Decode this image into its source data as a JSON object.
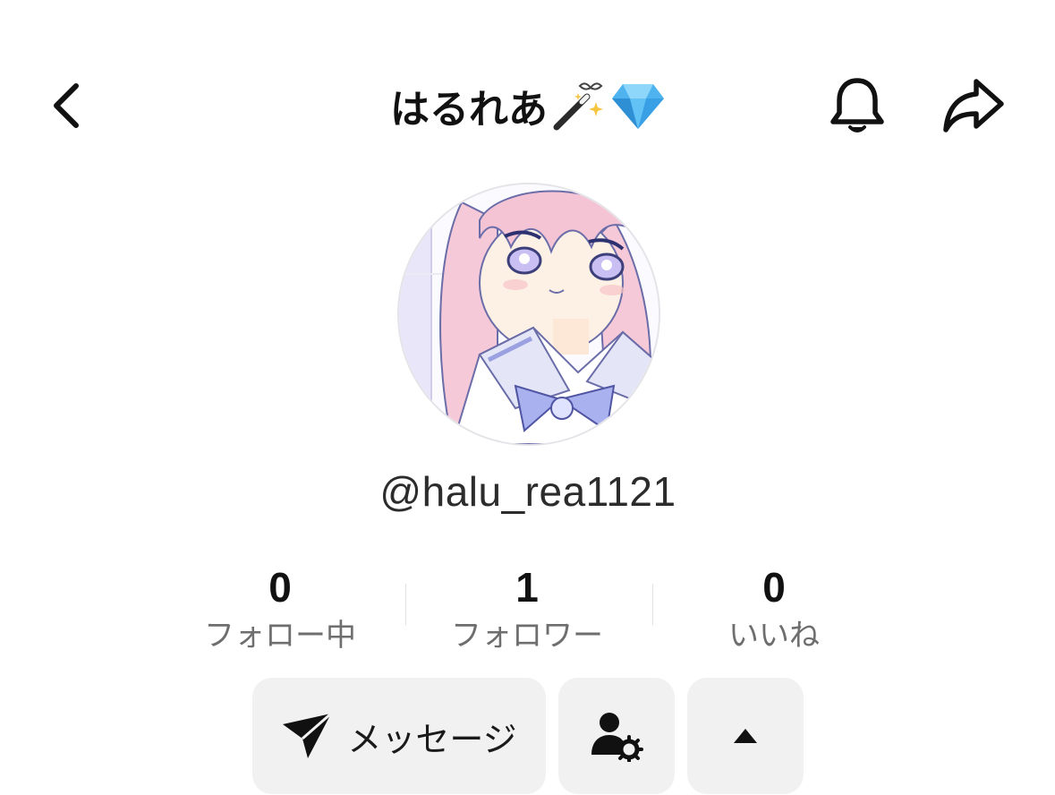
{
  "header": {
    "title": "はるれあ",
    "title_emojis": [
      "magic-wand-icon",
      "gem-icon"
    ],
    "back_icon": "chevron-left-icon",
    "bell_icon": "bell-icon",
    "share_icon": "share-arrow-icon"
  },
  "profile": {
    "avatar": "anime-girl-avatar",
    "username": "@halu_rea1121"
  },
  "stats": [
    {
      "count": "0",
      "label": "フォロー中"
    },
    {
      "count": "1",
      "label": "フォロワー"
    },
    {
      "count": "0",
      "label": "いいね"
    }
  ],
  "actions": {
    "message_label": "メッセージ",
    "message_icon": "send-icon",
    "profile_icon": "user-settings-icon",
    "more_icon": "caret-up-icon"
  },
  "colors": {
    "text": "#111111",
    "secondary_text": "#6e6e6e",
    "button_bg": "#f1f1f2",
    "gem": "#4fb3f0"
  }
}
